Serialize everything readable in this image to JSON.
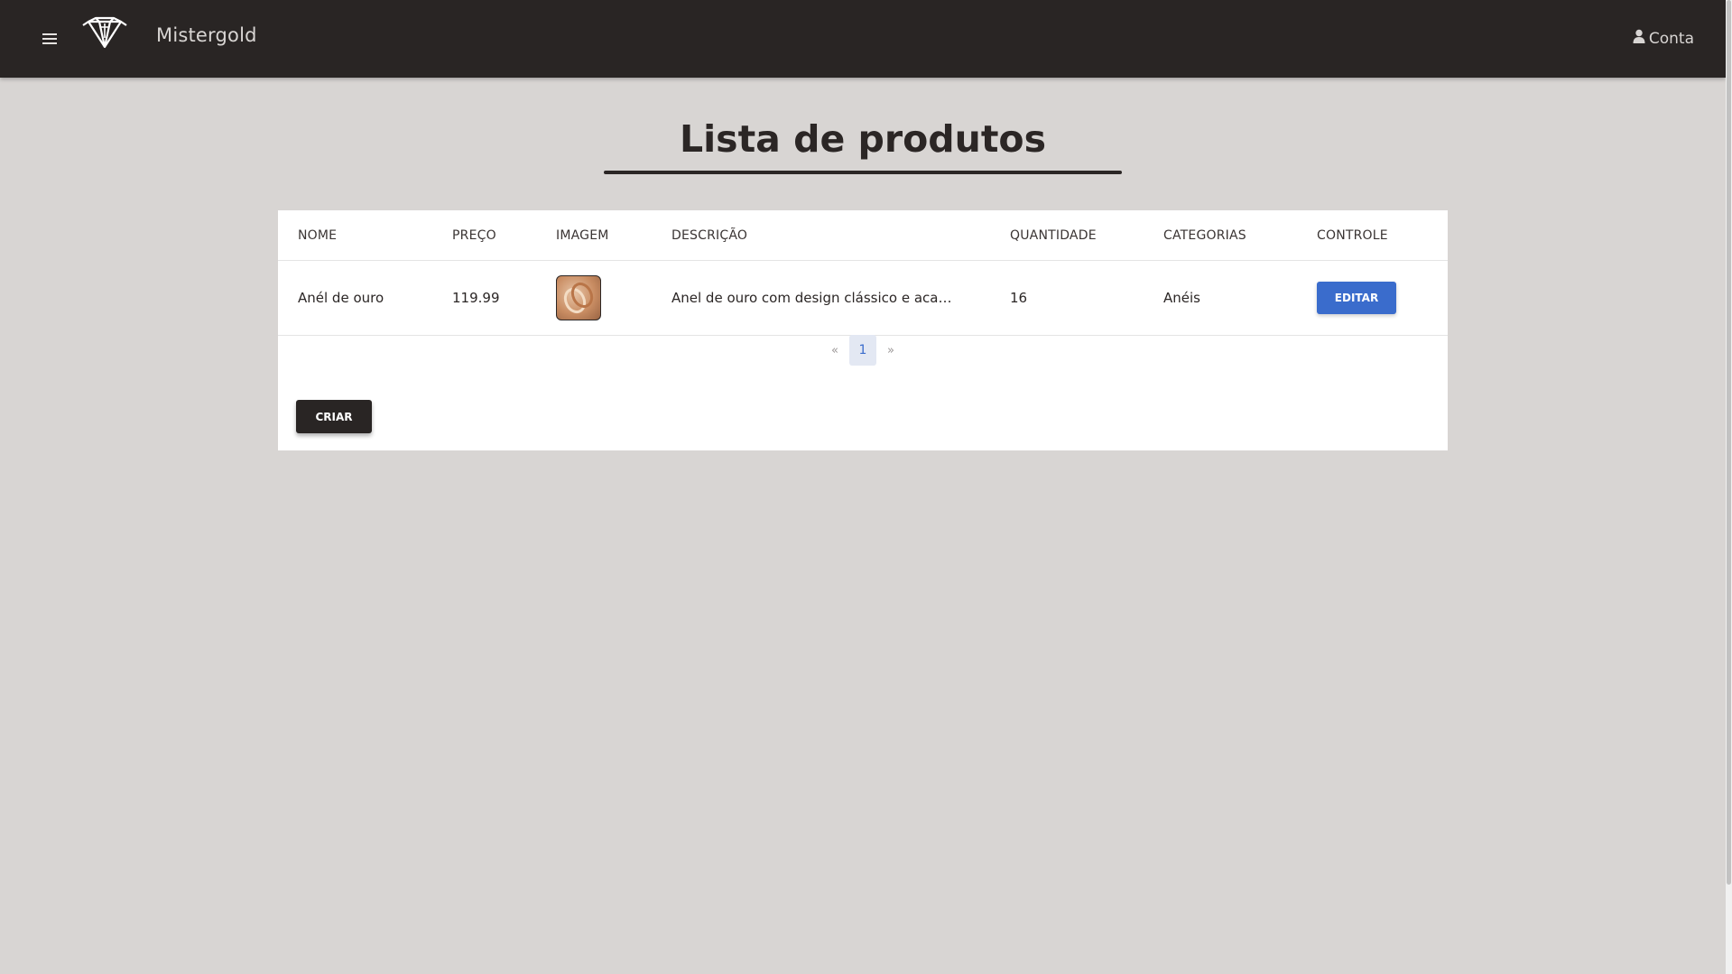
{
  "header": {
    "brand": "Mistergold",
    "account_label": "Conta"
  },
  "page": {
    "title": "Lista de produtos"
  },
  "table": {
    "columns": [
      "NOME",
      "PREÇO",
      "IMAGEM",
      "DESCRIÇÃO",
      "QUANTIDADE",
      "CATEGORIAS",
      "CONTROLE"
    ],
    "rows": [
      {
        "nome": "Anél de ouro",
        "preco": "119.99",
        "descricao": "Anel de ouro com design clássico e acaba...",
        "quantidade": "16",
        "categorias": "Anéis",
        "controle": "EDITAR"
      }
    ]
  },
  "pagination": {
    "prev": "«",
    "current": "1",
    "next": "»"
  },
  "actions": {
    "create_label": "CRIAR"
  },
  "colors": {
    "navbar": "#292524",
    "background": "#d8d5d3",
    "accent": "#3a6ccc"
  }
}
